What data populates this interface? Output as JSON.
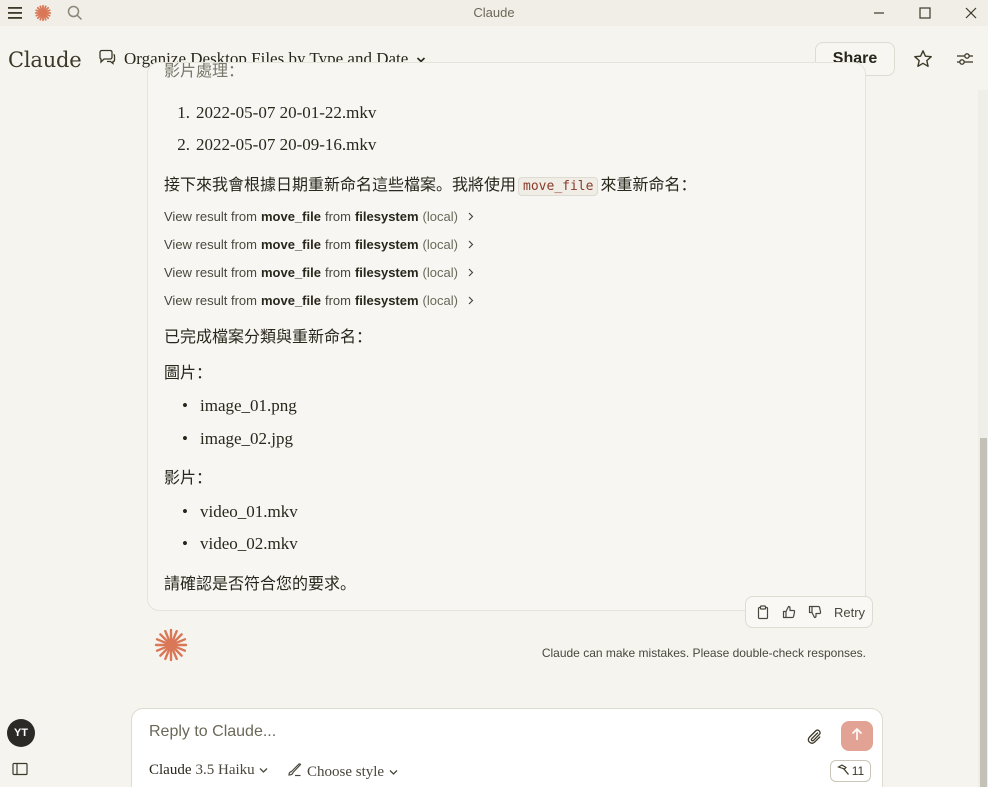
{
  "window": {
    "title": "Claude"
  },
  "header": {
    "brand": "Claude",
    "conversation_title": "Organize Desktop Files by Type and Date",
    "share_label": "Share"
  },
  "message": {
    "cut_off_text": "影片處理：",
    "ordered_items": [
      {
        "num": "1.",
        "text": "2022-05-07 20-01-22.mkv"
      },
      {
        "num": "2.",
        "text": "2022-05-07 20-09-16.mkv"
      }
    ],
    "rename_intro_before": "接下來我會根據日期重新命名這些檔案。我將使用",
    "rename_intro_code": "move_file",
    "rename_intro_after": "來重新命名：",
    "tool_results": [
      {
        "prefix": "View result from",
        "tool": "move_file",
        "mid": "from",
        "server": "filesystem",
        "scope": "(local)"
      },
      {
        "prefix": "View result from",
        "tool": "move_file",
        "mid": "from",
        "server": "filesystem",
        "scope": "(local)"
      },
      {
        "prefix": "View result from",
        "tool": "move_file",
        "mid": "from",
        "server": "filesystem",
        "scope": "(local)"
      },
      {
        "prefix": "View result from",
        "tool": "move_file",
        "mid": "from",
        "server": "filesystem",
        "scope": "(local)"
      }
    ],
    "done_text": "已完成檔案分類與重新命名：",
    "images_heading": "圖片：",
    "image_files": [
      "image_01.png",
      "image_02.jpg"
    ],
    "videos_heading": "影片：",
    "video_files": [
      "video_01.mkv",
      "video_02.mkv"
    ],
    "confirm_text": "請確認是否符合您的要求。"
  },
  "actions": {
    "retry_label": "Retry"
  },
  "disclaimer": "Claude can make mistakes. Please double-check responses.",
  "user": {
    "initials": "YT"
  },
  "composer": {
    "placeholder": "Reply to Claude...",
    "model_name": "Claude",
    "model_version": "3.5 Haiku",
    "style_label": "Choose style",
    "tools_count": "11"
  },
  "colors": {
    "accent": "#d97757",
    "send_button": "#e3a394",
    "background": "#f5f4ef"
  }
}
